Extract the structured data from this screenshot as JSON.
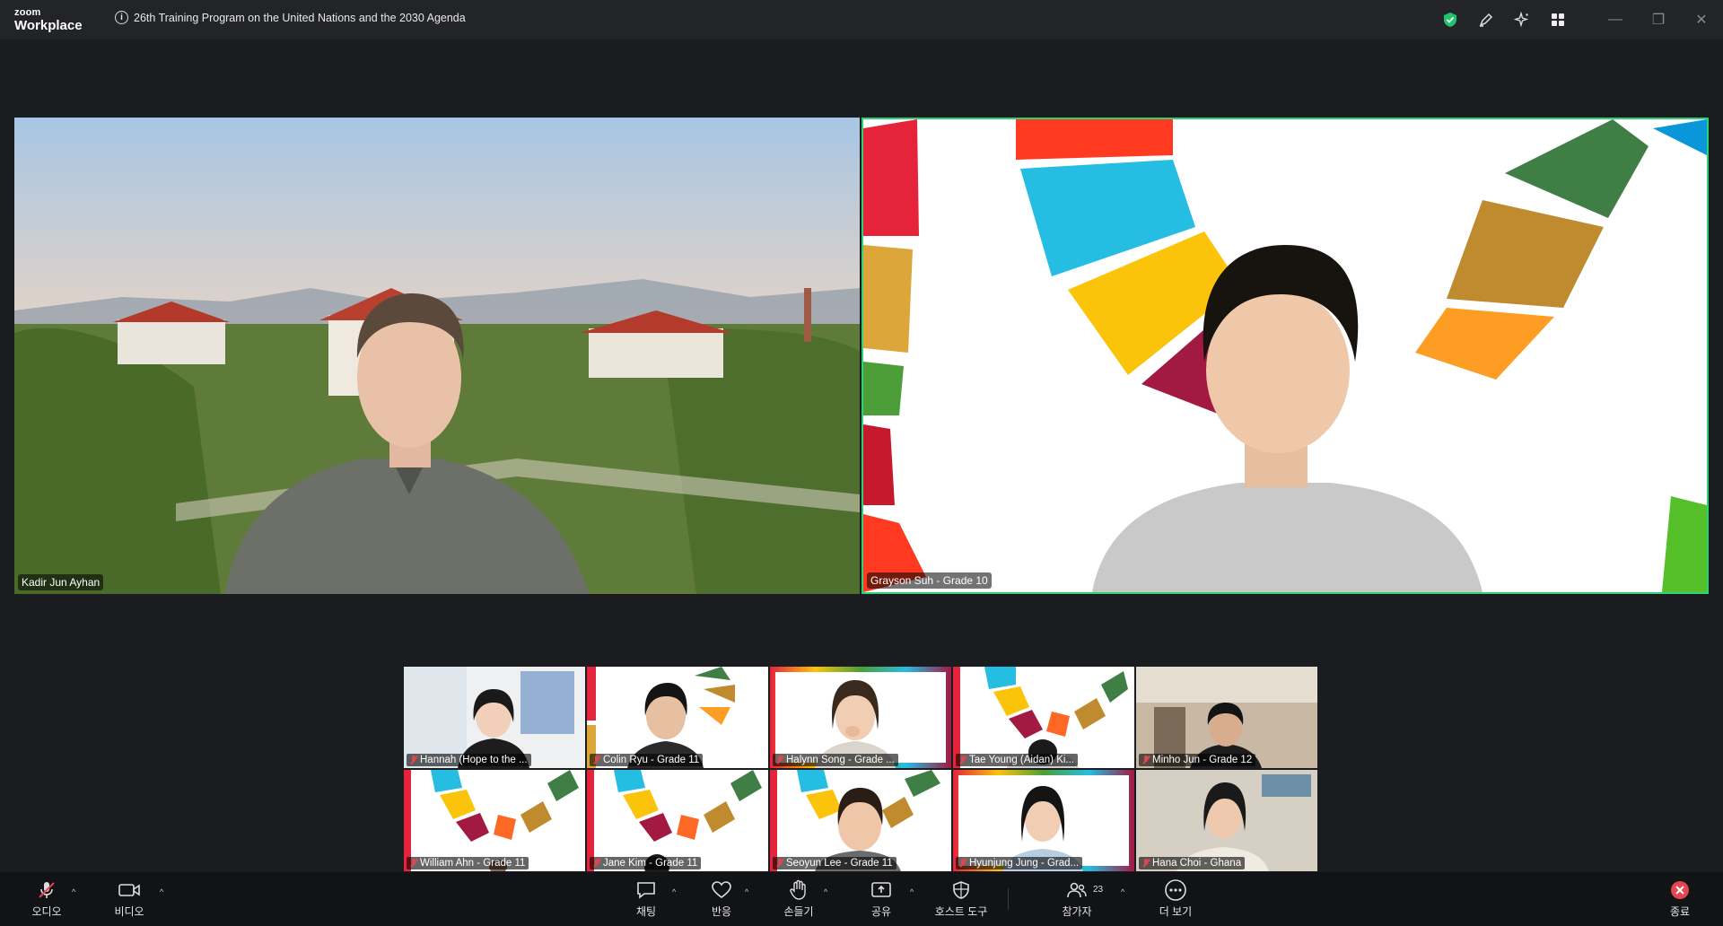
{
  "app": {
    "brand_top": "zoom",
    "brand_bottom": "Workplace"
  },
  "meeting": {
    "title": "26th Training Program on the United Nations and the 2030 Agenda"
  },
  "colors": {
    "accent_green": "#2fd078",
    "mic_muted_red": "#e0464e",
    "end_red": "#e0464e",
    "titlebar": "#232427",
    "background": "#1b1c1f"
  },
  "titlebar_icons": [
    "shield-icon",
    "pen-icon",
    "sparkle-icon",
    "apps-grid-icon"
  ],
  "main_tiles": [
    {
      "name": "Kadir Jun Ayhan"
    },
    {
      "name": "Grayson Suh - Grade 10"
    }
  ],
  "gallery": [
    {
      "name": "Hannah (Hope to the ..."
    },
    {
      "name": "Colin Ryu - Grade 11"
    },
    {
      "name": "Halynn Song - Grade ..."
    },
    {
      "name": "Tae Young (Aidan) Ki..."
    },
    {
      "name": "Minho Jun - Grade 12"
    },
    {
      "name": "William Ahn - Grade 11"
    },
    {
      "name": "Jane Kim - Grade 11"
    },
    {
      "name": "Seoyun Lee - Grade 11"
    },
    {
      "name": "Hyunjung Jung - Grad..."
    },
    {
      "name": "Hana Choi - Ghana"
    }
  ],
  "toolbar": {
    "audio": "오디오",
    "video": "비디오",
    "chat": "채팅",
    "reactions": "반응",
    "raise_hand": "손들기",
    "share": "공유",
    "host_tools": "호스트 도구",
    "participants": "참가자",
    "participants_count": "23",
    "more": "더 보기",
    "end": "종료"
  }
}
